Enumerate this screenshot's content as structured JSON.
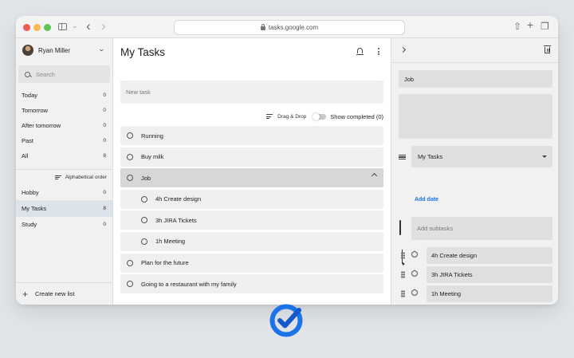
{
  "browser": {
    "url": "tasks.google.com"
  },
  "sidebar": {
    "user_name": "Ryan Miller",
    "search_placeholder": "Search",
    "filters": [
      {
        "label": "Today",
        "count": "0"
      },
      {
        "label": "Tomorrow",
        "count": "0"
      },
      {
        "label": "After tomorrow",
        "count": "0"
      },
      {
        "label": "Past",
        "count": "0"
      },
      {
        "label": "All",
        "count": "8"
      }
    ],
    "sort_label": "Alphabetical order",
    "lists": [
      {
        "label": "Hobby",
        "count": "0"
      },
      {
        "label": "My Tasks",
        "count": "8"
      },
      {
        "label": "Study",
        "count": "0"
      }
    ],
    "active_list": "My Tasks",
    "create_label": "Create new list"
  },
  "main": {
    "title": "My Tasks",
    "new_task_placeholder": "New task",
    "drag_drop_label": "Drag & Drop",
    "show_completed_label": "Show completed (0)",
    "show_completed_on": false,
    "tasks": [
      {
        "title": "Running"
      },
      {
        "title": "Buy milk"
      },
      {
        "title": "Job",
        "expanded": true,
        "selected": true
      },
      {
        "title": "4h Create design",
        "subtask": true
      },
      {
        "title": "3h JIRA Tickets",
        "subtask": true
      },
      {
        "title": "1h Meeting",
        "subtask": true
      },
      {
        "title": "Plan for the future"
      },
      {
        "title": "Going to a restaurant with my family"
      }
    ]
  },
  "detail": {
    "title": "Job",
    "list_select": "My Tasks",
    "add_date_label": "Add date",
    "add_subtasks_placeholder": "Add subtasks",
    "subtasks": [
      "4h Create design",
      "3h JIRA Tickets",
      "1h Meeting"
    ],
    "link_color": "#1a73e8"
  },
  "brand": {
    "logo_icon": "google-tasks-logo-icon",
    "colors": {
      "blue": "#1a73e8",
      "dark_blue": "#1558c9"
    }
  }
}
